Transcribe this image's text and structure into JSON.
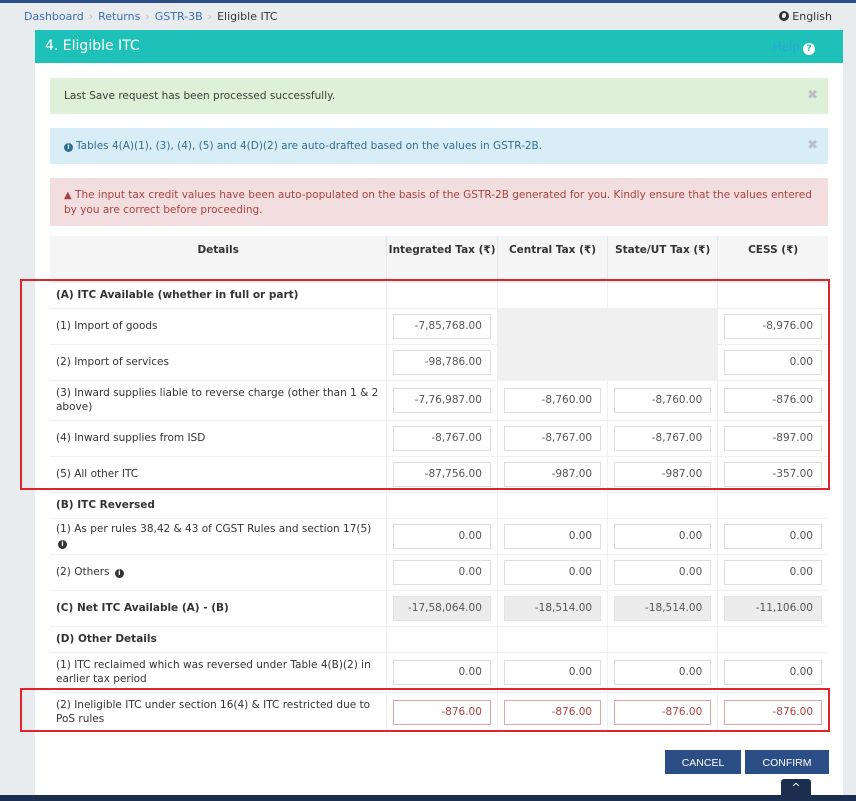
{
  "breadcrumb": {
    "items": [
      "Dashboard",
      "Returns",
      "GSTR-3B"
    ],
    "current": "Eligible ITC"
  },
  "language": {
    "label": "English",
    "icon": "globe-icon"
  },
  "panel": {
    "title": "4. Eligible ITC",
    "help_label": "Help",
    "help_icon": "?"
  },
  "alerts": {
    "success": "Last Save request has been processed successfully.",
    "info": "Tables 4(A)(1), (3), (4), (5) and 4(D)(2) are auto-drafted based on the values in GSTR-2B.",
    "danger": "The input tax credit values have been auto-populated on the basis of the GSTR-2B generated for you. Kindly ensure that the values entered by you are correct before proceeding.",
    "close_glyph": "✖",
    "info_glyph": "i",
    "warn_glyph": "▲"
  },
  "table": {
    "headers": [
      "Details",
      "Integrated Tax (₹)",
      "Central Tax (₹)",
      "State/UT Tax (₹)",
      "CESS (₹)"
    ],
    "sections": {
      "A": "(A) ITC Available (whether in full or part)",
      "B": "(B) ITC Reversed",
      "C": "(C) Net ITC Available (A) - (B)",
      "D": "(D) Other Details"
    },
    "rows": {
      "a1": {
        "label": "(1) Import of goods",
        "igst": "-7,85,768.00",
        "cess": "-8,976.00"
      },
      "a2": {
        "label": "(2) Import of services",
        "igst": "-98,786.00",
        "cess": "0.00"
      },
      "a3": {
        "label": "(3) Inward supplies liable to reverse charge (other than 1 & 2 above)",
        "igst": "-7,76,987.00",
        "cgst": "-8,760.00",
        "sgst": "-8,760.00",
        "cess": "-876.00"
      },
      "a4": {
        "label": "(4) Inward supplies from ISD",
        "igst": "-8,767.00",
        "cgst": "-8,767.00",
        "sgst": "-8,767.00",
        "cess": "-897.00"
      },
      "a5": {
        "label": "(5) All other ITC",
        "igst": "-87,756.00",
        "cgst": "-987.00",
        "sgst": "-987.00",
        "cess": "-357.00"
      },
      "b1": {
        "label": "(1) As per rules 38,42 & 43 of CGST Rules and section 17(5)",
        "igst": "0.00",
        "cgst": "0.00",
        "sgst": "0.00",
        "cess": "0.00"
      },
      "b2": {
        "label": "(2) Others",
        "igst": "0.00",
        "cgst": "0.00",
        "sgst": "0.00",
        "cess": "0.00"
      },
      "c": {
        "igst": "-17,58,064.00",
        "cgst": "-18,514.00",
        "sgst": "-18,514.00",
        "cess": "-11,106.00"
      },
      "d1": {
        "label": "(1) ITC reclaimed which was reversed under Table 4(B)(2) in earlier tax period",
        "igst": "0.00",
        "cgst": "0.00",
        "sgst": "0.00",
        "cess": "0.00"
      },
      "d2": {
        "label": "(2) Ineligible ITC under section 16(4) & ITC restricted due to PoS rules",
        "igst": "-876.00",
        "cgst": "-876.00",
        "sgst": "-876.00",
        "cess": "-876.00"
      }
    }
  },
  "buttons": {
    "cancel": "CANCEL",
    "confirm": "CONFIRM",
    "scroll_top": "^"
  },
  "colors": {
    "header": "#1ec1b8",
    "primary_button": "#2c4e86",
    "highlight": "#e0242e"
  }
}
